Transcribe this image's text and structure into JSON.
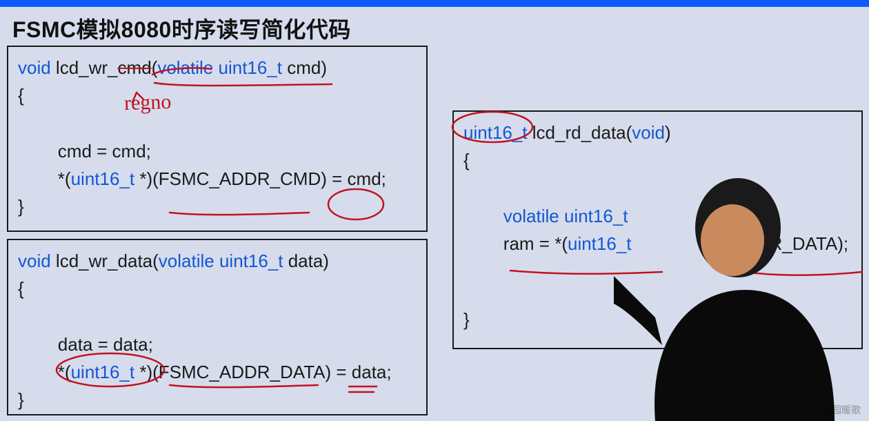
{
  "title": "FSMC模拟8080时序读写简化代码",
  "handwriting": {
    "regno": "regno"
  },
  "box1": {
    "sig_void": "void",
    "sig_fn": " lcd_wr_",
    "sig_cmd_struck": "cmd",
    "sig_paren_open": "(",
    "sig_volatile": "volatile",
    "sig_space": " ",
    "sig_type": "uint16_t",
    "sig_param": " cmd)",
    "brace_open": "{",
    "l1_a": "        cmd = cmd;",
    "l2_a": "        *(",
    "l2_type": "uint16_t",
    "l2_b": " *)(FSMC_ADDR_CMD) = ",
    "l2_cmd": "cmd",
    "l2_c": ";",
    "brace_close": "}"
  },
  "box2": {
    "sig_void": "void",
    "sig_fn": " lcd_wr_data(",
    "sig_volatile": "volatile",
    "sig_space": " ",
    "sig_type": "uint16_t",
    "sig_param": " data)",
    "brace_open": "{",
    "l1_a": "        data = data;",
    "l2_a": "        *(",
    "l2_type": "uint16_t",
    "l2_b": " *)(FSMC_ADDR_DATA) = data;",
    "brace_close": "}"
  },
  "box3": {
    "sig_type": "uint16_t",
    "sig_fn": " lcd_rd_data(",
    "sig_void": "void",
    "sig_close": ")",
    "brace_open": "{",
    "l1_a": "        ",
    "l1_volatile": "volatile",
    "l1_space": " ",
    "l1_type": "uint16_t",
    "l2_a": "        ram = *(",
    "l2_type": "uint16_t",
    "l2_tail": "R_DATA);",
    "brace_close": "}"
  },
  "footer": "CSDN @清园暖歌"
}
